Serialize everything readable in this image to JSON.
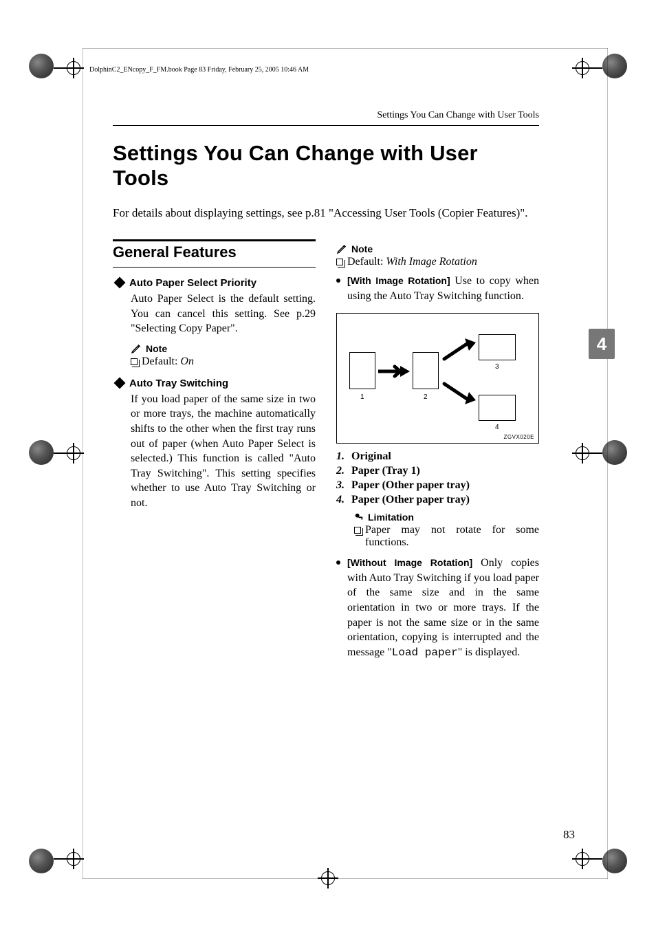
{
  "book_stamp": "DolphinC2_ENcopy_F_FM.book  Page 83  Friday, February 25, 2005  10:46 AM",
  "running_head": "Settings You Can Change with User Tools",
  "title": "Settings You Can Change with User Tools",
  "intro": "For details about displaying settings, see p.81 \"Accessing User Tools (Copier Features)\".",
  "section_heading": "General Features",
  "left": {
    "feat1_title": "Auto Paper Select Priority",
    "feat1_body": "Auto Paper Select is the default setting. You can cancel this setting. See p.29 \"Selecting Copy Paper\".",
    "note_label": "Note",
    "note_default_prefix": "Default: ",
    "note_default_value": "On",
    "feat2_title": "Auto Tray Switching",
    "feat2_body": "If you load paper of the same size in two or more trays, the machine automatically shifts to the other when the first tray runs out of paper (when Auto Paper Select is selected.) This function is called \"Auto Tray Switching\". This setting specifies whether to use Auto Tray Switching or not."
  },
  "right": {
    "note_label": "Note",
    "note_default_prefix": "Default: ",
    "note_default_value": "With Image Rotation",
    "opt1_label": "[With Image Rotation]",
    "opt1_text": " Use to copy when using the Auto Tray Switching function.",
    "diagram": {
      "l1": "1",
      "l2": "2",
      "l3": "3",
      "l4": "4",
      "code": "ZGVX020E"
    },
    "enum": [
      {
        "n": "1.",
        "label": "Original"
      },
      {
        "n": "2.",
        "label": "Paper (Tray 1)"
      },
      {
        "n": "3.",
        "label": "Paper (Other paper tray)"
      },
      {
        "n": "4.",
        "label": "Paper (Other paper tray)"
      }
    ],
    "lim_label": "Limitation",
    "lim_text": "Paper may not rotate for some functions.",
    "opt2_label": "[Without Image Rotation]",
    "opt2_text_a": " Only copies with Auto Tray Switching if you load paper of the same size and in the same orientation in two or more trays. If the paper is not the same size or in the same orientation, copying is interrupted and the message \"",
    "opt2_code": "Load paper",
    "opt2_text_b": "\" is displayed."
  },
  "thumb_tab": "4",
  "page_number": "83"
}
